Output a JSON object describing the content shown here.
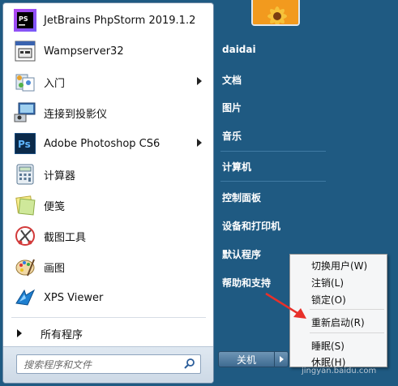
{
  "programs": [
    {
      "label": "JetBrains PhpStorm 2019.1.2",
      "icon": "phpstorm-icon",
      "submenu": false
    },
    {
      "label": "Wampserver32",
      "icon": "wampserver-icon",
      "submenu": false
    },
    {
      "label": "入门",
      "icon": "getting-started-icon",
      "submenu": true
    },
    {
      "label": "连接到投影仪",
      "icon": "projector-icon",
      "submenu": false
    },
    {
      "label": "Adobe Photoshop CS6",
      "icon": "photoshop-icon",
      "submenu": true
    },
    {
      "label": "计算器",
      "icon": "calculator-icon",
      "submenu": false
    },
    {
      "label": "便笺",
      "icon": "sticky-notes-icon",
      "submenu": false
    },
    {
      "label": "截图工具",
      "icon": "snipping-tool-icon",
      "submenu": false
    },
    {
      "label": "画图",
      "icon": "paint-icon",
      "submenu": false
    },
    {
      "label": "XPS Viewer",
      "icon": "xps-viewer-icon",
      "submenu": false
    }
  ],
  "all_programs": "所有程序",
  "search": {
    "placeholder": "搜索程序和文件"
  },
  "right_links": {
    "user": "daidai",
    "documents": "文档",
    "pictures": "图片",
    "music": "音乐",
    "computer": "计算机",
    "control_panel": "控制面板",
    "devices": "设备和打印机",
    "default_programs": "默认程序",
    "help": "帮助和支持"
  },
  "shutdown": {
    "label": "关机"
  },
  "context_menu": {
    "switch_user": "切换用户(W)",
    "logoff": "注销(L)",
    "lock": "锁定(O)",
    "restart": "重新启动(R)",
    "sleep": "睡眠(S)",
    "hibernate": "休眠(H)"
  },
  "watermark": "jingyan.baidu.com",
  "colors": {
    "accent_red": "#e8302a",
    "panel_blue": "#1f5a82"
  }
}
